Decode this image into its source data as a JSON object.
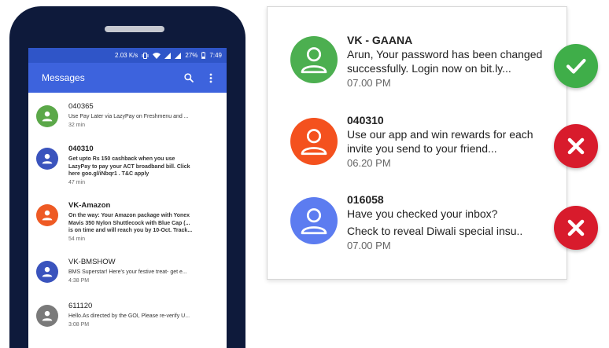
{
  "phone": {
    "status_bar": {
      "speed": "2.03 K/s",
      "battery": "27%",
      "time": "7:49"
    },
    "app_bar": {
      "title": "Messages",
      "search_icon": "search-icon",
      "menu_icon": "more-vert-icon"
    },
    "messages": [
      {
        "sender": "040365",
        "body_lines": [
          "Use Pay Later via LazyPay on Freshmenu and ..."
        ],
        "time": "32 min",
        "unread": false,
        "avatar_color": "#5ba849"
      },
      {
        "sender": "040310",
        "body_lines": [
          "Get upto Rs 150 cashback when you use",
          "LazyPay to pay your ACT broadband bill. Click",
          "here goo.gl/iNbqr1 . T&C apply"
        ],
        "time": "47 min",
        "unread": true,
        "avatar_color": "#3a53bd"
      },
      {
        "sender": "VK-Amazon",
        "body_lines": [
          "On the way: Your Amazon package with Yonex",
          "Mavis 350 Nylon Shuttlecock with Blue Cap (...",
          "is on time and will reach you by 10-Oct. Track..."
        ],
        "time": "54 min",
        "unread": true,
        "avatar_color": "#ee5a24"
      },
      {
        "sender": "VK-BMSHOW",
        "body_lines": [
          "BMS Superstar! Here's your festive treat- get e..."
        ],
        "time": "4:38 PM",
        "unread": false,
        "avatar_color": "#3a53bd"
      },
      {
        "sender": "611120",
        "body_lines": [
          "Hello.As directed by the GOI, Please re-verify U..."
        ],
        "time": "3:08 PM",
        "unread": false,
        "avatar_color": "#7a7a7a"
      }
    ]
  },
  "card": {
    "rows": [
      {
        "sender": "VK - GAANA",
        "lines": [
          "Arun, Your password has been changed",
          "successfully. Login now on bit.ly..."
        ],
        "time": "07.00 PM",
        "avatar_color": "#4caf50",
        "verdict": "approved",
        "verdict_icon": "checkmark-icon",
        "verdict_color": "#3fae49"
      },
      {
        "sender": "040310",
        "lines": [
          "Use our app and win rewards for each",
          "invite you send to your friend..."
        ],
        "time": "06.20 PM",
        "avatar_color": "#f4511e",
        "verdict": "rejected",
        "verdict_icon": "cross-icon",
        "verdict_color": "#d81b2c"
      },
      {
        "sender": "016058",
        "lines": [
          "Have you checked your inbox?",
          "Check to reveal Diwali special insu.."
        ],
        "time": "07.00 PM",
        "avatar_color": "#5c7cf0",
        "verdict": "rejected",
        "verdict_icon": "cross-icon",
        "verdict_color": "#d81b2c"
      }
    ]
  }
}
